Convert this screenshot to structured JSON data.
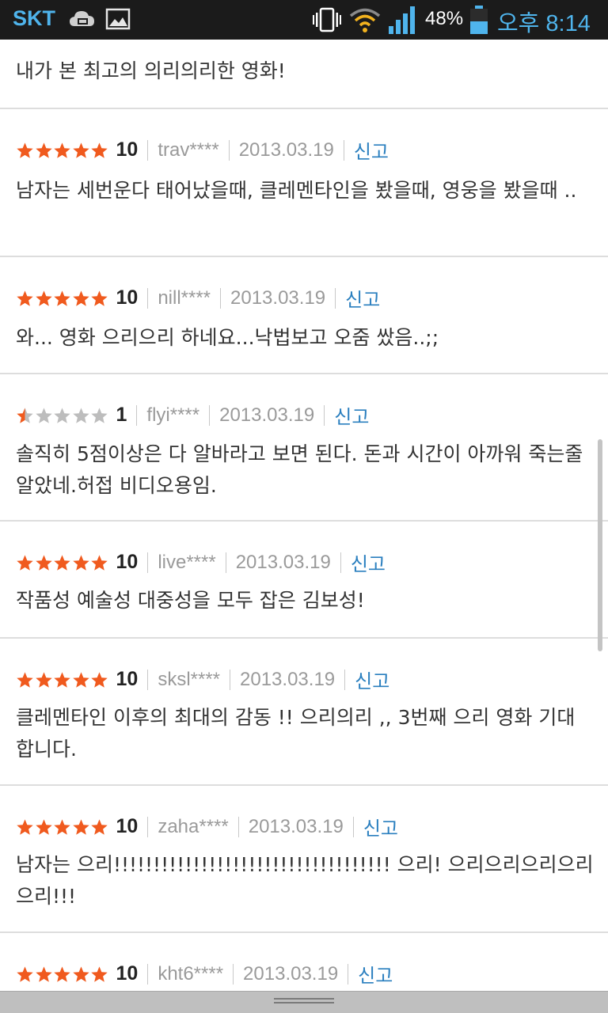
{
  "status_bar": {
    "carrier": "SKT",
    "battery_percent": "48%",
    "time": "오후 8:14",
    "icons": [
      "cloud-icon",
      "gallery-icon",
      "vibrate-icon",
      "wifi-icon",
      "signal-icon",
      "battery-icon"
    ],
    "accent_color": "#4fb4ec"
  },
  "report_label": "신고",
  "colors": {
    "star_on": "#f05a1e",
    "star_off": "#bdbdbd",
    "report_link": "#2a7fbf"
  },
  "partial_review": {
    "comment": "내가 본 최고의 의리의리한 영화!"
  },
  "reviews": [
    {
      "rating": 10,
      "stars": 5,
      "score": "10",
      "user": "trav****",
      "date": "2013.03.19",
      "comment": "남자는 세번운다 태어났을때, 클레멘타인을 봤을때, 영웅을 봤을때 .."
    },
    {
      "rating": 10,
      "stars": 5,
      "score": "10",
      "user": "nill****",
      "date": "2013.03.19",
      "comment": "와... 영화 으리으리 하네요...낙법보고 오줌 쌌음..;;"
    },
    {
      "rating": 1,
      "stars": 0.5,
      "score": "1",
      "user": "flyi****",
      "date": "2013.03.19",
      "comment": "솔직히 5점이상은 다 알바라고 보면 된다. 돈과 시간이 아까워 죽는줄 알았네.허접 비디오용임."
    },
    {
      "rating": 10,
      "stars": 5,
      "score": "10",
      "user": "live****",
      "date": "2013.03.19",
      "comment": "작품성 예술성 대중성을 모두 잡은 김보성!"
    },
    {
      "rating": 10,
      "stars": 5,
      "score": "10",
      "user": "sksl****",
      "date": "2013.03.19",
      "comment": "클레멘타인 이후의 최대의 감동 !! 으리의리 ,, 3번째 으리 영화 기대합니다."
    },
    {
      "rating": 10,
      "stars": 5,
      "score": "10",
      "user": "zaha****",
      "date": "2013.03.19",
      "comment": "남자는 으리!!!!!!!!!!!!!!!!!!!!!!!!!!!!!!!!!!! 으리! 으리으리으리으리 으리!!!"
    },
    {
      "rating": 10,
      "stars": 5,
      "score": "10",
      "user": "kht6****",
      "date": "2013.03.19",
      "comment": ""
    }
  ]
}
